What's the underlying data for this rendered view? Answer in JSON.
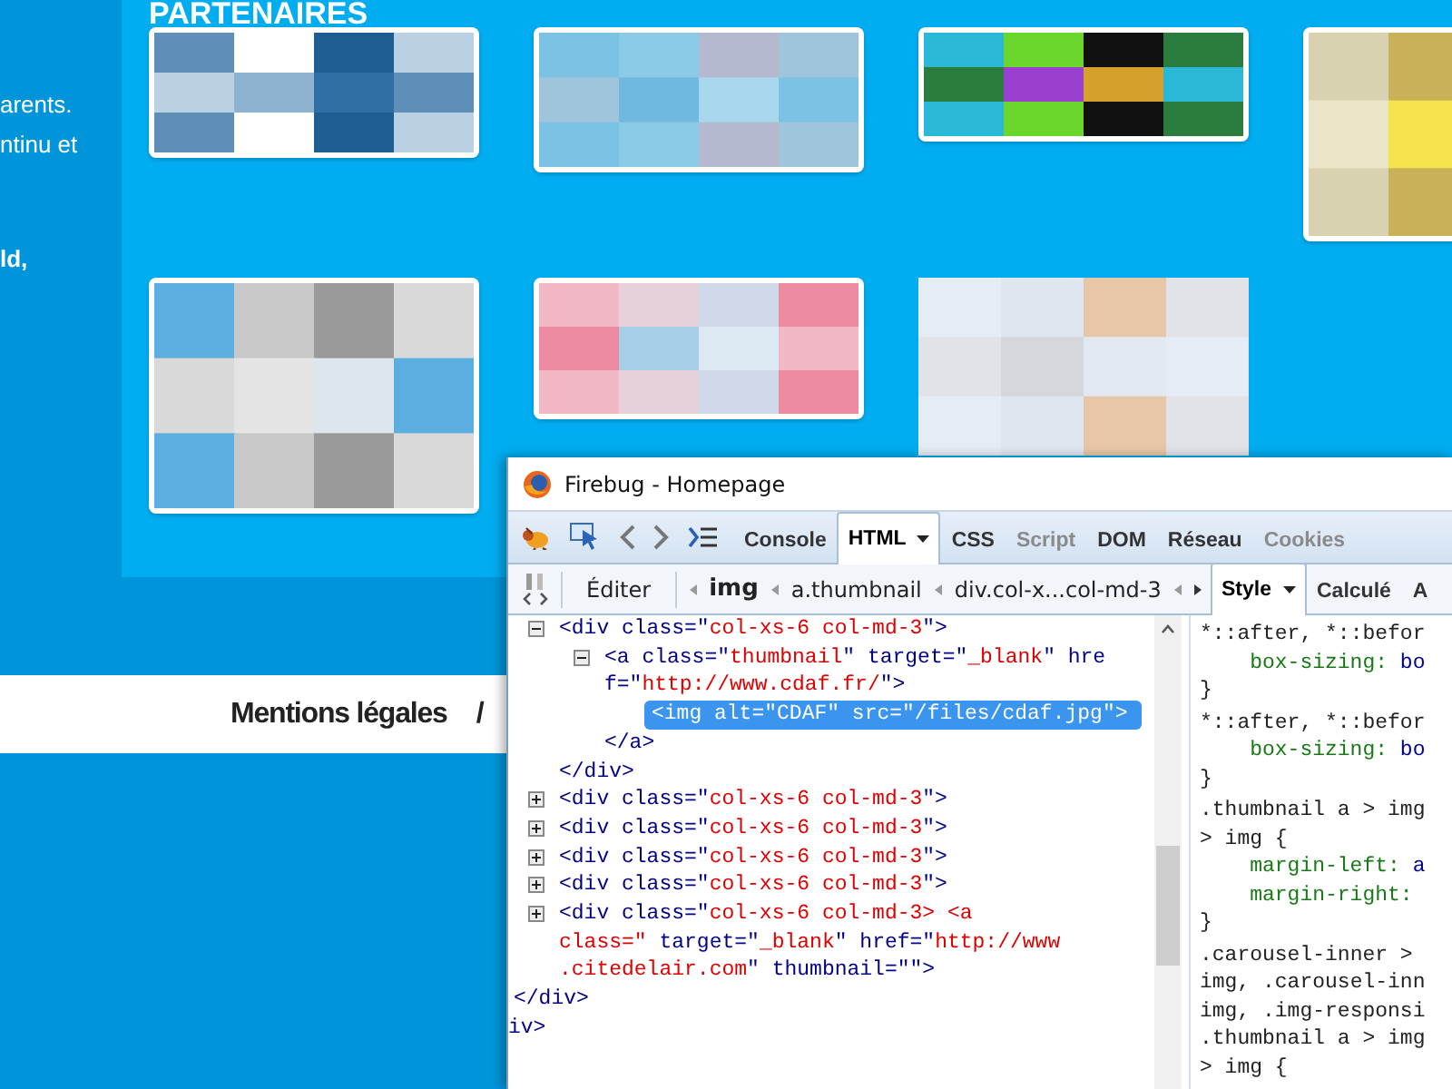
{
  "sidebar": {
    "paragraphs": [
      {
        "bold": false,
        "lines": [
          "arents.",
          "ntinu et"
        ]
      },
      {
        "bold": true,
        "lines": [
          "ld,"
        ]
      }
    ]
  },
  "partners": {
    "heading": "PARTENAIRES"
  },
  "footer": {
    "link": "Mentions légales",
    "separator": "/"
  },
  "firebug": {
    "title": "Firebug - Homepage",
    "tabs": [
      {
        "label": "Console",
        "selected": false,
        "disabled": false,
        "dropdown": false
      },
      {
        "label": "HTML",
        "selected": true,
        "disabled": false,
        "dropdown": true
      },
      {
        "label": "CSS",
        "selected": false,
        "disabled": false,
        "dropdown": false
      },
      {
        "label": "Script",
        "selected": false,
        "disabled": true,
        "dropdown": false
      },
      {
        "label": "DOM",
        "selected": false,
        "disabled": false,
        "dropdown": false
      },
      {
        "label": "Réseau",
        "selected": false,
        "disabled": false,
        "dropdown": false
      },
      {
        "label": "Cookies",
        "selected": false,
        "disabled": true,
        "dropdown": false
      }
    ],
    "edit_label": "Éditer",
    "breadcrumbs": [
      {
        "label": "img",
        "selected": true
      },
      {
        "label": "a.thumbnail",
        "selected": false
      },
      {
        "label": "div.col-x...col-md-3",
        "selected": false
      }
    ],
    "side_tabs": [
      {
        "label": "Style",
        "selected": true
      },
      {
        "label": "Calculé",
        "selected": false
      },
      {
        "label": "A",
        "selected": false
      }
    ],
    "html_tree": {
      "children": [
        {
          "expanded": true,
          "selected": false,
          "open": [
            [
              {
                "kind": "tag",
                "text": "<div class=\""
              },
              {
                "kind": "value",
                "text": "col-xs-6 col-md-3"
              },
              {
                "kind": "tag",
                "text": "\">"
              }
            ]
          ],
          "children": [
            {
              "expanded": true,
              "selected": false,
              "open": [
                [
                  {
                    "kind": "tag",
                    "text": "<a class=\""
                  },
                  {
                    "kind": "value",
                    "text": "thumbnail"
                  },
                  {
                    "kind": "tag",
                    "text": "\" target=\""
                  },
                  {
                    "kind": "value",
                    "text": "_blank"
                  },
                  {
                    "kind": "tag",
                    "text": "\" hre"
                  }
                ],
                [
                  {
                    "kind": "tag",
                    "text": "f=\""
                  },
                  {
                    "kind": "value",
                    "text": "http://www.cdaf.fr/"
                  },
                  {
                    "kind": "tag",
                    "text": "\">"
                  }
                ]
              ],
              "children": [
                {
                  "selected": true,
                  "open": [
                    [
                      {
                        "text": "<img alt=\"CDAF\" src=\"/files/cdaf.jpg\">"
                      }
                    ]
                  ]
                }
              ],
              "close": "</a>"
            }
          ],
          "close": "</div>"
        },
        {
          "expanded": false,
          "selected": false,
          "open": [
            [
              {
                "kind": "tag",
                "text": "<div class=\""
              },
              {
                "kind": "value",
                "text": "col-xs-6 col-md-3"
              },
              {
                "kind": "tag",
                "text": "\">"
              }
            ]
          ]
        },
        {
          "expanded": false,
          "selected": false,
          "open": [
            [
              {
                "kind": "tag",
                "text": "<div class=\""
              },
              {
                "kind": "value",
                "text": "col-xs-6 col-md-3"
              },
              {
                "kind": "tag",
                "text": "\">"
              }
            ]
          ]
        },
        {
          "expanded": false,
          "selected": false,
          "open": [
            [
              {
                "kind": "tag",
                "text": "<div class=\""
              },
              {
                "kind": "value",
                "text": "col-xs-6 col-md-3"
              },
              {
                "kind": "tag",
                "text": "\">"
              }
            ]
          ]
        },
        {
          "expanded": false,
          "selected": false,
          "open": [
            [
              {
                "kind": "tag",
                "text": "<div class=\""
              },
              {
                "kind": "value",
                "text": "col-xs-6 col-md-3"
              },
              {
                "kind": "tag",
                "text": "\">"
              }
            ]
          ]
        },
        {
          "expanded": false,
          "selected": false,
          "open": [
            [
              {
                "kind": "tag",
                "text": "<div class=\""
              },
              {
                "kind": "value",
                "text": "col-xs-6 col-md-3> <a"
              }
            ],
            [
              {
                "kind": "value",
                "text": "class=\""
              },
              {
                "kind": "tag",
                "text": " target=\""
              },
              {
                "kind": "value",
                "text": "_blank"
              },
              {
                "kind": "tag",
                "text": "\" href=\""
              },
              {
                "kind": "value",
                "text": "http://www"
              }
            ],
            [
              {
                "kind": "value",
                "text": ".citedelair.com"
              },
              {
                "kind": "tag",
                "text": "\" thumbnail=\"\">"
              }
            ]
          ]
        }
      ],
      "close": "</div>",
      "parent_close": "iv>"
    },
    "css_rules": [
      {
        "selectors": [
          "*::after, *::befor"
        ],
        "declarations": [
          {
            "property": "box-sizing:",
            "value": "bo"
          }
        ],
        "close": "}"
      },
      {
        "selectors": [
          "*::after, *::befor"
        ],
        "declarations": [
          {
            "property": "box-sizing:",
            "value": "bo"
          }
        ],
        "close": "}"
      },
      {
        "selectors": [
          ".thumbnail a > img",
          "> img {"
        ],
        "declarations": [
          {
            "property": "margin-left:",
            "value": "a"
          },
          {
            "property": "margin-right:"
          }
        ],
        "close": "}"
      },
      {
        "selectors": [
          ".carousel-inner > ",
          "img, .carousel-inn",
          "img, .img-responsi",
          ".thumbnail a > img",
          "> img {"
        ]
      }
    ]
  }
}
